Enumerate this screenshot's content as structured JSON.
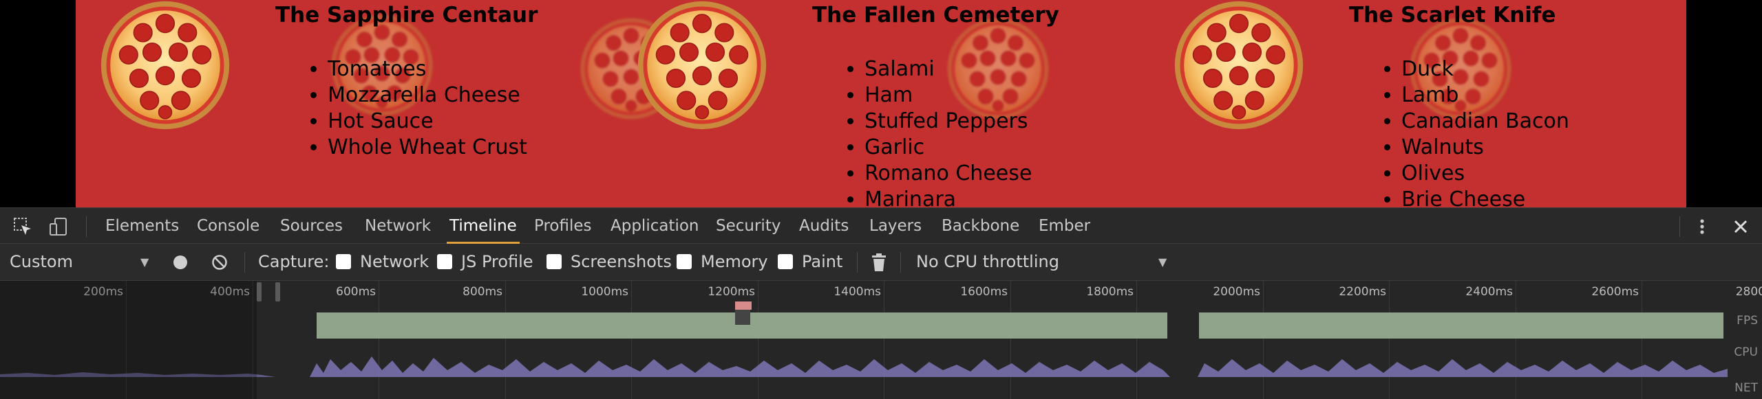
{
  "cards": [
    {
      "title": "The Sapphire Centaur",
      "ingredients": [
        "Tomatoes",
        "Mozzarella Cheese",
        "Hot Sauce",
        "Whole Wheat Crust"
      ]
    },
    {
      "title": "The Fallen Cemetery",
      "ingredients": [
        "Salami",
        "Ham",
        "Stuffed Peppers",
        "Garlic",
        "Romano Cheese",
        "Marinara"
      ]
    },
    {
      "title": "The Scarlet Knife",
      "ingredients": [
        "Duck",
        "Lamb",
        "Canadian Bacon",
        "Walnuts",
        "Olives",
        "Brie Cheese"
      ]
    }
  ],
  "devtools": {
    "tabs": [
      "Elements",
      "Console",
      "Sources",
      "Network",
      "Timeline",
      "Profiles",
      "Application",
      "Security",
      "Audits",
      "Layers",
      "Backbone",
      "Ember"
    ],
    "active_tab": "Timeline",
    "icons": {
      "inspect": "inspect-element-icon",
      "device": "device-toolbar-icon",
      "more": "more-vertical-icon",
      "close": "close-icon"
    },
    "toolbar": {
      "preset": "Custom",
      "capture_label": "Capture:",
      "checkboxes": [
        "Network",
        "JS Profile",
        "Screenshots",
        "Memory",
        "Paint"
      ],
      "throttling": "No CPU throttling"
    },
    "timeline": {
      "ticks": [
        "200ms",
        "400ms",
        "600ms",
        "800ms",
        "1000ms",
        "1200ms",
        "1400ms",
        "1600ms",
        "1800ms",
        "2000ms",
        "2200ms",
        "2400ms",
        "2600ms",
        "2800"
      ],
      "lanes": [
        "FPS",
        "CPU",
        "NET"
      ]
    }
  },
  "colors": {
    "page_bg": "#c4302f",
    "devtools_bg": "#2b2b2b",
    "active_tab_underline": "#e0a13b",
    "fps_bar": "#8fa48a",
    "cpu_fill": "#7c76b5"
  }
}
